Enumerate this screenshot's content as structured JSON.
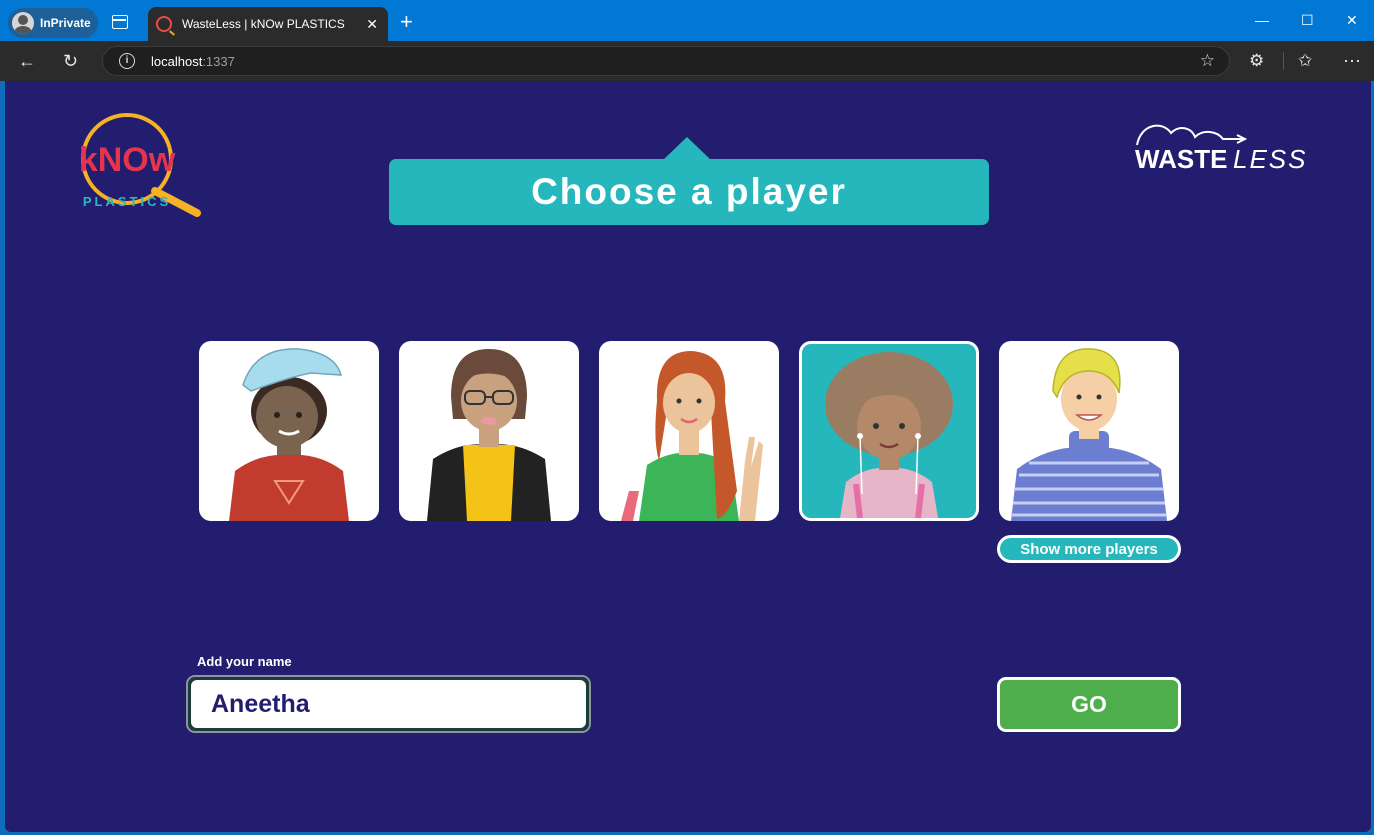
{
  "browser": {
    "profile_label": "InPrivate",
    "tab_title": "WasteLess | kNOw PLASTICS",
    "url_host": "localhost",
    "url_port": ":1337"
  },
  "logos": {
    "know_text": "kNOw",
    "plastics_text": "PLASTICS",
    "waste_text": "WASTE",
    "less_text": "LESS"
  },
  "header": {
    "title": "Choose a player"
  },
  "players": [
    {
      "selected": false,
      "shirt": "#c13b2f",
      "skin": "#7a6450"
    },
    {
      "selected": false,
      "shirt": "#f3c318",
      "skin": "#c9a17f"
    },
    {
      "selected": false,
      "shirt": "#3bb557",
      "skin": "#ecc49c"
    },
    {
      "selected": true,
      "shirt": "#e7b5c8",
      "skin": "#b4896a"
    },
    {
      "selected": false,
      "shirt": "#6b7ed2",
      "skin": "#f5cfa6"
    }
  ],
  "show_more_label": "Show more players",
  "name": {
    "label": "Add your name",
    "value": "Aneetha"
  },
  "go_label": "GO",
  "colors": {
    "background": "#221d6e",
    "accent_teal": "#25b7bb",
    "go_green": "#4fae4c"
  }
}
